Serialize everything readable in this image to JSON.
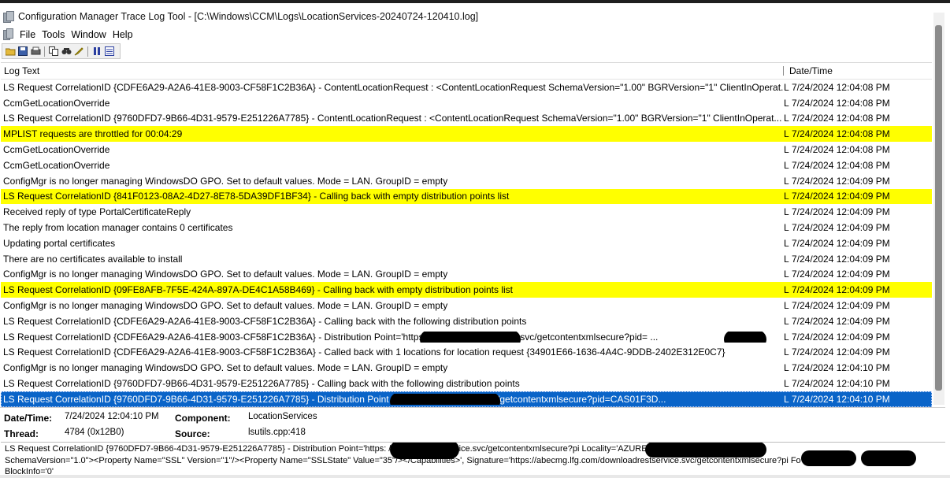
{
  "window": {
    "title": "Configuration Manager Trace Log Tool - [C:\\Windows\\CCM\\Logs\\LocationServices-20240724-120410.log]"
  },
  "menu": [
    "File",
    "Tools",
    "Window",
    "Help"
  ],
  "toolbar": {
    "icons": [
      "open-icon",
      "save-icon",
      "print-icon",
      "copy-icon",
      "find-icon",
      "highlight-icon",
      "pause-icon",
      "filter-icon"
    ]
  },
  "grid": {
    "headers": {
      "log": "Log Text",
      "date": "Date/Time"
    },
    "rows": [
      {
        "log": "LS Request CorrelationID {CDFE6A29-A2A6-41E8-9003-CF58F1C2B36A} - ContentLocationRequest : <ContentLocationRequest SchemaVersion=\"1.00\" BGRVersion=\"1\" ClientInOperat...",
        "comp": "L",
        "date": "7/24/2024 12:04:08 PM",
        "state": "normal"
      },
      {
        "log": "CcmGetLocationOverride",
        "comp": "L",
        "date": "7/24/2024 12:04:08 PM",
        "state": "normal"
      },
      {
        "log": "LS Request CorrelationID {9760DFD7-9B66-4D31-9579-E251226A7785} - ContentLocationRequest : <ContentLocationRequest SchemaVersion=\"1.00\" BGRVersion=\"1\" ClientInOperat...",
        "comp": "L",
        "date": "7/24/2024 12:04:08 PM",
        "state": "normal"
      },
      {
        "log": "MPLIST requests are throttled for 00:04:29",
        "comp": "L",
        "date": "7/24/2024 12:04:08 PM",
        "state": "highlight"
      },
      {
        "log": "CcmGetLocationOverride",
        "comp": "L",
        "date": "7/24/2024 12:04:08 PM",
        "state": "normal"
      },
      {
        "log": "CcmGetLocationOverride",
        "comp": "L",
        "date": "7/24/2024 12:04:08 PM",
        "state": "normal"
      },
      {
        "log": "ConfigMgr is no longer managing WindowsDO GPO.  Set to default values. Mode = LAN. GroupID = empty",
        "comp": "L",
        "date": "7/24/2024 12:04:09 PM",
        "state": "normal"
      },
      {
        "log": "LS Request CorrelationID {841F0123-08A2-4D27-8E78-5DA39DF1BF34} - Calling back with empty distribution points list",
        "comp": "L",
        "date": "7/24/2024 12:04:09 PM",
        "state": "highlight"
      },
      {
        "log": "Received reply of type PortalCertificateReply",
        "comp": "L",
        "date": "7/24/2024 12:04:09 PM",
        "state": "normal"
      },
      {
        "log": "The reply from location manager contains 0 certificates",
        "comp": "L",
        "date": "7/24/2024 12:04:09 PM",
        "state": "normal"
      },
      {
        "log": "Updating portal certificates",
        "comp": "L",
        "date": "7/24/2024 12:04:09 PM",
        "state": "normal"
      },
      {
        "log": "There are no certificates available to install",
        "comp": "L",
        "date": "7/24/2024 12:04:09 PM",
        "state": "normal"
      },
      {
        "log": "ConfigMgr is no longer managing WindowsDO GPO.  Set to default values. Mode = LAN. GroupID = empty",
        "comp": "L",
        "date": "7/24/2024 12:04:09 PM",
        "state": "normal"
      },
      {
        "log": "LS Request CorrelationID {09FE8AFB-7F5E-424A-897A-DE4C1A58B469} - Calling back with empty distribution points list",
        "comp": "L",
        "date": "7/24/2024 12:04:09 PM",
        "state": "highlight"
      },
      {
        "log": "ConfigMgr is no longer managing WindowsDO GPO.  Set to default values. Mode = LAN. GroupID = empty",
        "comp": "L",
        "date": "7/24/2024 12:04:09 PM",
        "state": "normal"
      },
      {
        "log": "LS Request CorrelationID {CDFE6A29-A2A6-41E8-9003-CF58F1C2B36A} - Calling back with the following distribution points",
        "comp": "L",
        "date": "7/24/2024 12:04:09 PM",
        "state": "normal"
      },
      {
        "log": "LS Request CorrelationID {CDFE6A29-A2A6-41E8-9003-CF58F1C2B36A} - Distribution Point='https:                              /downloadrestservice.svc/getcontentxmlsecure?pid=             ...",
        "comp": "L",
        "date": "7/24/2024 12:04:09 PM",
        "state": "normal",
        "redacted": true
      },
      {
        "log": "LS Request CorrelationID {CDFE6A29-A2A6-41E8-9003-CF58F1C2B36A} - Called back with 1 locations for location request {34901E66-1636-4A4C-9DDB-2402E312E0C7}",
        "comp": "L",
        "date": "7/24/2024 12:04:09 PM",
        "state": "normal"
      },
      {
        "log": "ConfigMgr is no longer managing WindowsDO GPO.  Set to default values. Mode = LAN. GroupID = empty",
        "comp": "L",
        "date": "7/24/2024 12:04:10 PM",
        "state": "normal"
      },
      {
        "log": "LS Request CorrelationID {9760DFD7-9B66-4D31-9579-E251226A7785} - Calling back with the following distribution points",
        "comp": "L",
        "date": "7/24/2024 12:04:10 PM",
        "state": "normal"
      },
      {
        "log": "LS Request CorrelationID {9760DFD7-9B66-4D31-9579-E251226A7785} - Distribution Point                              /downloadrestservice.svc/getcontentxmlsecure?pid=CAS01F3D...",
        "comp": "L",
        "date": "7/24/2024 12:04:10 PM",
        "state": "selected",
        "redacted": true
      }
    ]
  },
  "details": {
    "datetime_label": "Date/Time:",
    "datetime_value": "7/24/2024 12:04:10 PM",
    "component_label": "Component:",
    "component_value": "LocationServices",
    "thread_label": "Thread:",
    "thread_value": "4784 (0x12B0)",
    "source_label": "Source:",
    "source_value": "lsutils.cpp:418"
  },
  "message": {
    "lines": [
      "LS Request CorrelationID {9760DFD7-9B66-4D31-9579-E251226A7785} - Distribution Point='https:                              /downloadrestservice.svc/getcontentxmlsecure?pi                                       Locality='AZURE' Version='9106' Capabili",
      "SchemaVersion=\"1.0\"><Property Name=\"SSL\" Version=\"1\"/><Property Name=\"SSLState\" Value=\"35\"/></Capabilities>', Signature='https://abecmg.lfg.com/downloadrestservice.svc/getcontentxmlsecure?pi                                                          Fo",
      "BlockInfo='0'"
    ]
  },
  "colors": {
    "highlight": "#ffff00",
    "selected": "#0a64c8",
    "redaction": "#000000"
  }
}
